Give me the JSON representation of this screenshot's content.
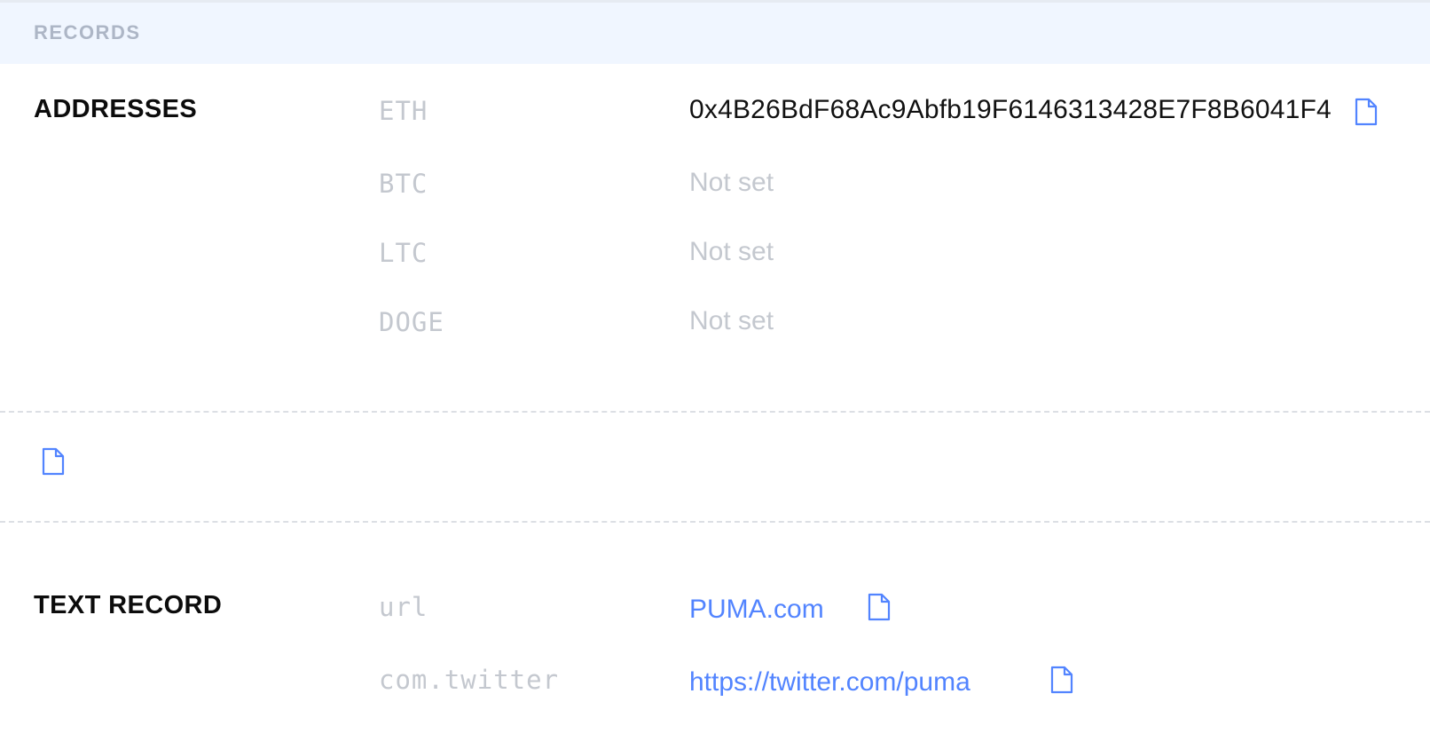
{
  "header": {
    "label": "RECORDS"
  },
  "addresses": {
    "title": "ADDRESSES",
    "rows": [
      {
        "key": "ETH",
        "value": "0x4B26BdF68Ac9Abfb19F6146313428E7F8B6041F4",
        "state": "set"
      },
      {
        "key": "BTC",
        "value": "Not set",
        "state": "unset"
      },
      {
        "key": "LTC",
        "value": "Not set",
        "state": "unset"
      },
      {
        "key": "DOGE",
        "value": "Not set",
        "state": "unset"
      }
    ]
  },
  "content_hash": {
    "icon": "file-copy-icon"
  },
  "text_record": {
    "title": "TEXT RECORD",
    "rows": [
      {
        "key": "url",
        "value": "PUMA.com"
      },
      {
        "key": "com.twitter",
        "value": "https://twitter.com/puma"
      }
    ]
  },
  "colors": {
    "accent": "#5284ff",
    "muted": "#c4c8cf",
    "header_bg": "#f0f6ff"
  }
}
